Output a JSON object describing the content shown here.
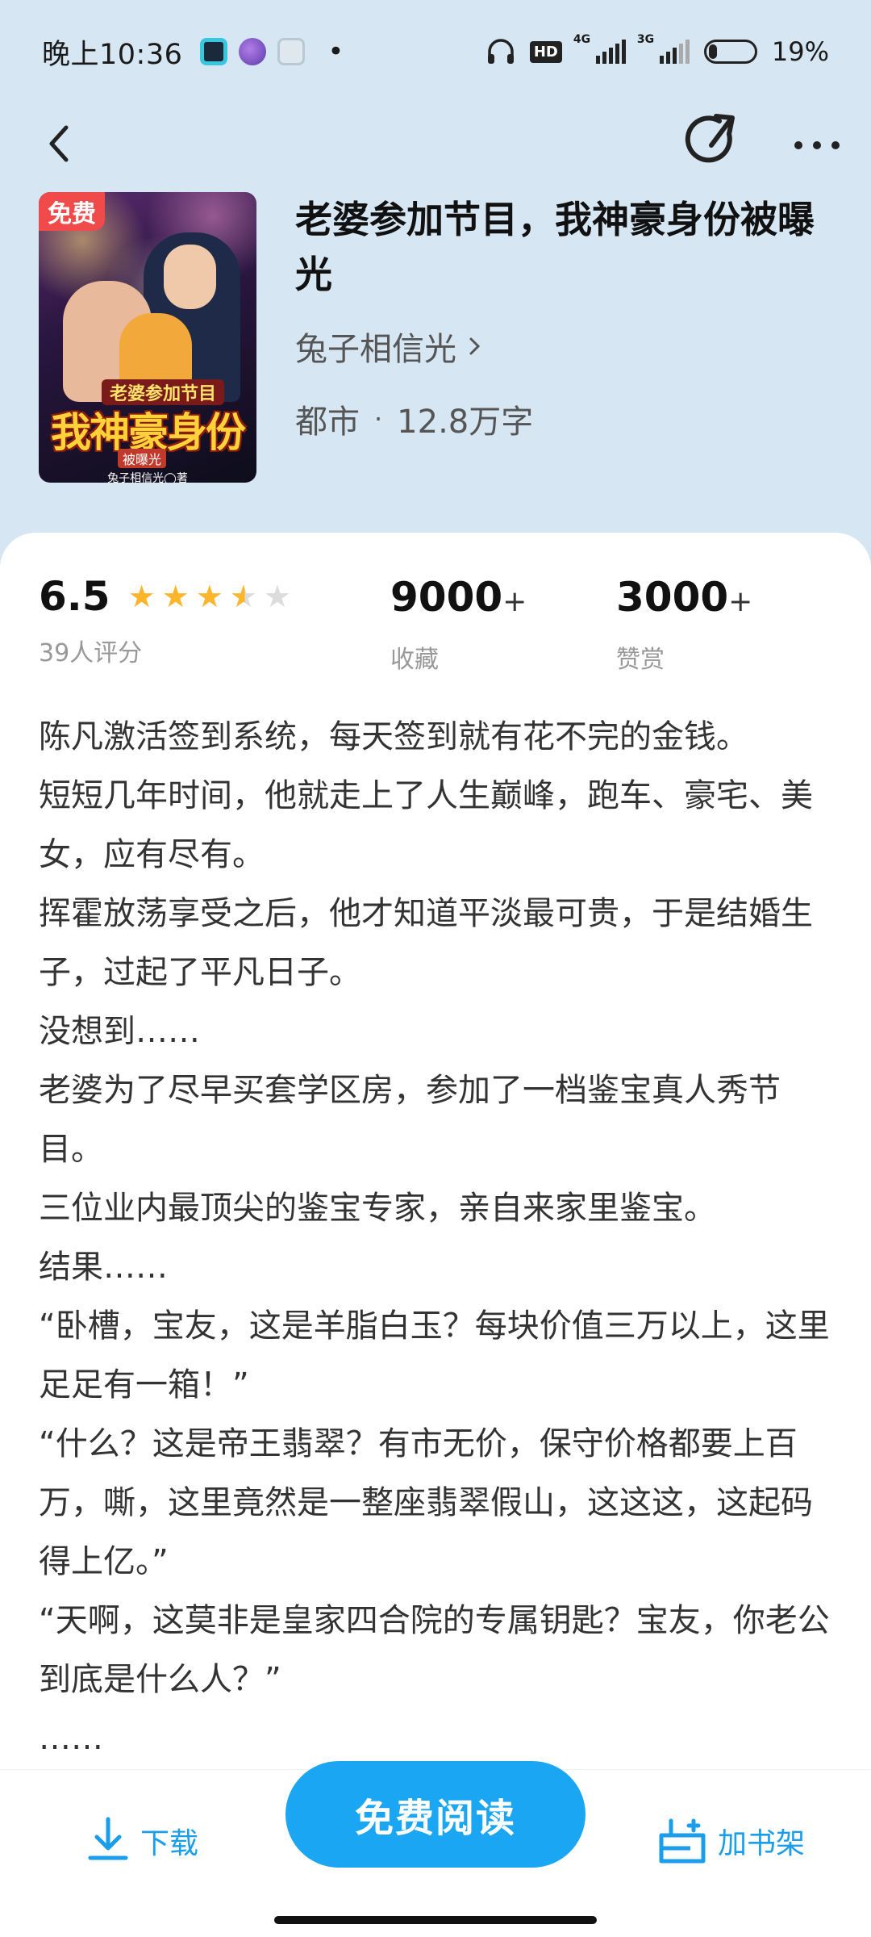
{
  "status_bar": {
    "time": "晚上10:36",
    "net1": "4G",
    "net2": "3G",
    "hd": "HD",
    "battery": "19%"
  },
  "book": {
    "free_badge": "免费",
    "title": "老婆参加节目，我神豪身份被曝光",
    "author": "兔子相信光",
    "genre": "都市",
    "word_count": "12.8万字",
    "cover": {
      "subtitle": "老婆参加节目",
      "title": "我神豪身份",
      "tag": "被曝光",
      "author": "兔子相信光◯著"
    }
  },
  "stats": {
    "rating": "6.5",
    "rating_stars": 3.5,
    "rating_count": "39人评分",
    "favorites": "9000",
    "favorites_label": "收藏",
    "rewards": "3000",
    "rewards_label": "赞赏",
    "plus": "+"
  },
  "synopsis": [
    "陈凡激活签到系统，每天签到就有花不完的金钱。",
    "短短几年时间，他就走上了人生巅峰，跑车、豪宅、美女，应有尽有。",
    "挥霍放荡享受之后，他才知道平淡最可贵，于是结婚生子，过起了平凡日子。",
    "没想到……",
    "老婆为了尽早买套学区房，参加了一档鉴宝真人秀节目。",
    "三位业内最顶尖的鉴宝专家，亲自来家里鉴宝。",
    "结果……",
    "“卧槽，宝友，这是羊脂白玉？每块价值三万以上，这里足足有一箱！”",
    "“什么？这是帝王翡翠？有市无价，保守价格都要上百万，嘶，这里竟然是一整座翡翠假山，这这这，这起码得上亿。”",
    "“天啊，这莫非是皇家四合院的专属钥匙？宝友，你老公到底是什么人？”",
    "……"
  ],
  "bottom_bar": {
    "download": "下载",
    "read": "免费阅读",
    "add_shelf": "加书架"
  },
  "colors": {
    "header_bg": "#d6e6f2",
    "accent": "#1aa6f2",
    "star": "#fdb52a",
    "free_badge": "#f04a4a"
  }
}
